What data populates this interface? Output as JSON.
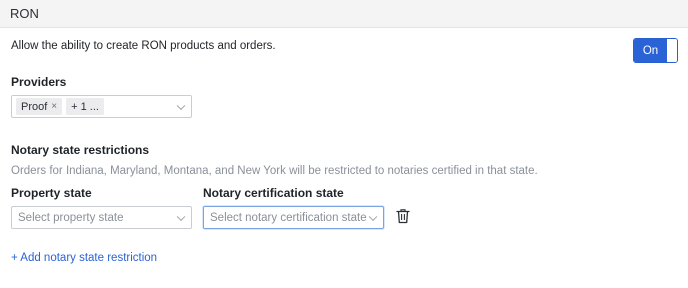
{
  "section": {
    "title": "RON"
  },
  "setting": {
    "allow_text": "Allow the ability to create RON products and orders.",
    "toggle_label": "On"
  },
  "providers": {
    "label": "Providers",
    "tags": [
      {
        "label": "Proof",
        "remove": "×"
      },
      {
        "label": "+ 1 ..."
      }
    ]
  },
  "restrictions": {
    "heading": "Notary state restrictions",
    "description": "Orders for Indiana, Maryland, Montana, and New York will be restricted to notaries certified in that state.",
    "property_state_label": "Property state",
    "property_state_placeholder": "Select property state",
    "cert_state_label": "Notary certification state",
    "cert_state_placeholder": "Select notary certification state",
    "add_link": "+ Add notary state restriction"
  },
  "icons": {
    "delete": "trash-icon",
    "dropdown": "chevron-down-icon"
  },
  "colors": {
    "accent": "#2a63d6",
    "header_bg": "#f4f4f5"
  }
}
